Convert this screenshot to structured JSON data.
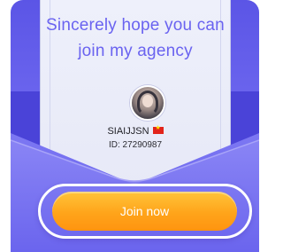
{
  "invite": {
    "headline_line1": "Sincerely hope you can",
    "headline_line2": "join my agency"
  },
  "user": {
    "name": "SIAIJJSN",
    "flag_icon": "vietnam-flag-icon",
    "id_text": "ID: 27290987"
  },
  "actions": {
    "join_label": "Join now"
  },
  "colors": {
    "accent": "#6a63f0",
    "envelope": "#5b55e6",
    "button": "#ffa41a"
  }
}
